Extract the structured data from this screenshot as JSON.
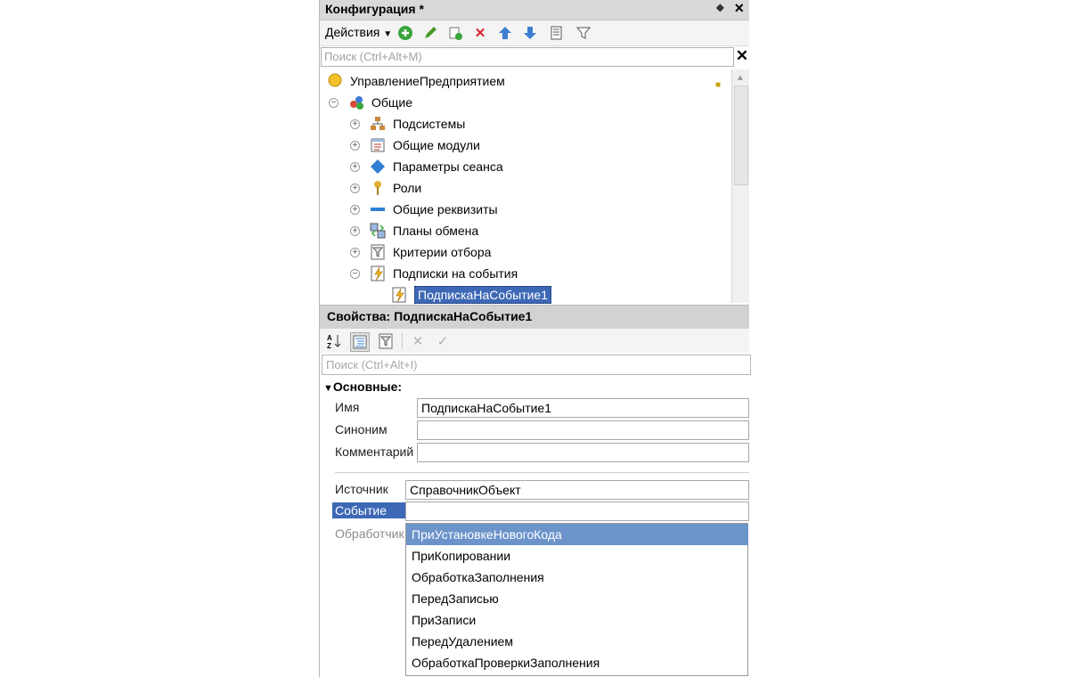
{
  "config_panel": {
    "title": "Конфигурация *",
    "pin_icon": "pin-icon",
    "close_icon": "×",
    "actions_label": "Действия",
    "search_placeholder": "Поиск (Ctrl+Alt+M)",
    "tree": [
      {
        "label": "УправлениеПредприятием",
        "icon": "config-root-icon",
        "level": 0,
        "expander": "none"
      },
      {
        "label": "Общие",
        "icon": "common-icon",
        "level": 1,
        "expander": "minus"
      },
      {
        "label": "Подсистемы",
        "icon": "subsystems-icon",
        "level": 2,
        "expander": "plus"
      },
      {
        "label": "Общие модули",
        "icon": "module-icon",
        "level": 2,
        "expander": "plus"
      },
      {
        "label": "Параметры сеанса",
        "icon": "session-params-icon",
        "level": 2,
        "expander": "plus"
      },
      {
        "label": "Роли",
        "icon": "role-icon",
        "level": 2,
        "expander": "plus"
      },
      {
        "label": "Общие реквизиты",
        "icon": "attribute-icon",
        "level": 2,
        "expander": "plus"
      },
      {
        "label": "Планы обмена",
        "icon": "exchange-plan-icon",
        "level": 2,
        "expander": "plus"
      },
      {
        "label": "Критерии отбора",
        "icon": "filter-criteria-icon",
        "level": 2,
        "expander": "plus"
      },
      {
        "label": "Подписки на события",
        "icon": "event-subscription-icon",
        "level": 2,
        "expander": "minus"
      },
      {
        "label": "ПодпискаНаСобытие1",
        "icon": "event-subscription-icon",
        "level": 3,
        "expander": "none",
        "selected": true
      }
    ]
  },
  "properties_panel": {
    "title": "Свойства: ПодпискаНаСобытие1",
    "search_placeholder": "Поиск (Ctrl+Alt+I)",
    "group_label": "Основные:",
    "fields": {
      "name_label": "Имя",
      "name_value": "ПодпискаНаСобытие1",
      "synonym_label": "Синоним",
      "synonym_value": "",
      "comment_label": "Комментарий",
      "comment_value": "",
      "source_label": "Источник",
      "source_value": "СправочникОбъект",
      "event_label": "Событие",
      "event_value": "",
      "handler_label": "Обработчик"
    },
    "event_options": [
      "ПриУстановкеНовогоКода",
      "ПриКопировании",
      "ОбработкаЗаполнения",
      "ПередЗаписью",
      "ПриЗаписи",
      "ПередУдалением",
      "ОбработкаПроверкиЗаполнения"
    ],
    "highlighted_option": 0
  },
  "colors": {
    "selection": "#3d68b5",
    "dropdown_highlight": "#6c94cb",
    "header_bg": "#d9d9d9"
  }
}
